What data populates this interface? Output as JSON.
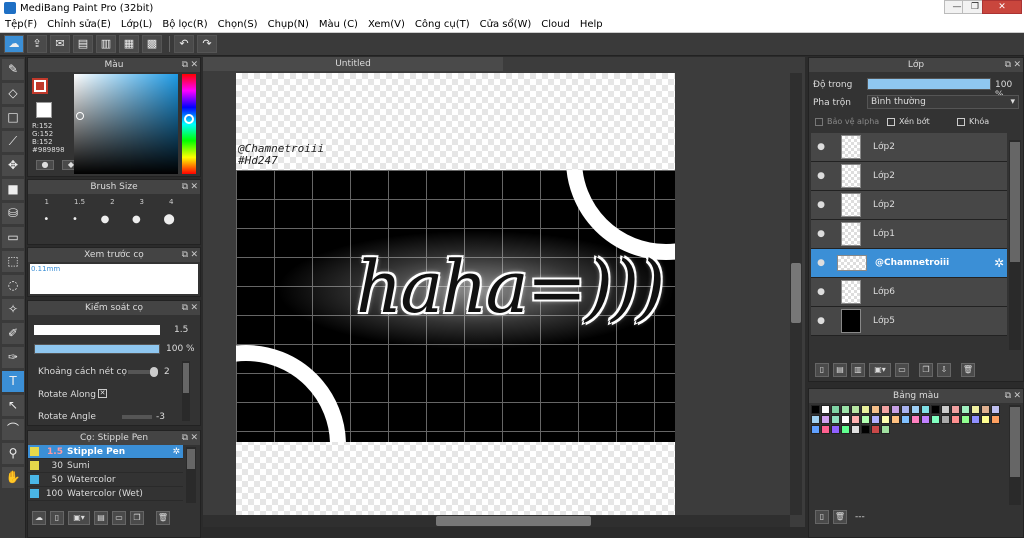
{
  "window": {
    "title": "MediBang Paint Pro (32bit)"
  },
  "menu": [
    "Tệp(F)",
    "Chỉnh sửa(E)",
    "Lớp(L)",
    "Bộ lọc(R)",
    "Chọn(S)",
    "Chụp(N)",
    "Màu (C)",
    "Xem(V)",
    "Công cụ(T)",
    "Cửa sổ(W)",
    "Cloud",
    "Help"
  ],
  "color_panel": {
    "title": "Màu",
    "r": "R:152",
    "g": "G:152",
    "b": "B:152",
    "hex": "#989898",
    "primary": "#c0392b",
    "secondary": "#989898"
  },
  "brush_size_panel": {
    "title": "Brush Size",
    "sizes": [
      "1",
      "1.5",
      "2",
      "3",
      "4"
    ]
  },
  "preview_panel": {
    "title": "Xem trước cọ",
    "value": "0.11mm"
  },
  "brush_control": {
    "title": "Kiểm soát cọ",
    "size_value": "1.5",
    "opacity_value": "100 %",
    "spacing_label": "Khoảng cách nét cọ",
    "spacing_value": "2",
    "rotate_along_label": "Rotate Along",
    "rotate_angle_label": "Rotate Angle",
    "rotate_angle_value": "-3"
  },
  "brush_list": {
    "title": "Cọ: Stipple Pen",
    "items": [
      {
        "size": "1.5",
        "name": "Stipple Pen",
        "color": "#e6d84a"
      },
      {
        "size": "30",
        "name": "Sumi",
        "color": "#e6d84a"
      },
      {
        "size": "50",
        "name": "Watercolor",
        "color": "#4ab6e6"
      },
      {
        "size": "100",
        "name": "Watercolor (Wet)",
        "color": "#4ab6e6"
      }
    ]
  },
  "document": {
    "tab": "Untitled",
    "credit_line1": "@Chamnetroiii",
    "credit_line2": "#Hd247",
    "art_text": "haha=)))"
  },
  "layer_panel": {
    "title": "Lớp",
    "opacity_label": "Độ trong",
    "opacity_value": "100 %",
    "opacity_fraction": 1.0,
    "blend_label": "Pha trộn",
    "blend_value": "Bình thường",
    "protect_alpha": "Bảo vệ alpha",
    "clipping": "Xén bớt",
    "lock": "Khóa",
    "layers": [
      "Lớp2",
      "Lớp2",
      "Lớp2",
      "Lớp1",
      "@Chamnetroiii",
      "Lớp6",
      "Lớp5"
    ],
    "selected_index": 4
  },
  "palette_panel": {
    "title": "Bảng màu",
    "colors": [
      "#000000",
      "#ffffff",
      "#7fd3a4",
      "#9be3a8",
      "#b7e6a3",
      "#e9f09c",
      "#f5c08a",
      "#f3a3a3",
      "#c7a0e5",
      "#a9b3f0",
      "#9fd0f5",
      "#7fe0e6",
      "#000000",
      "#cccccc",
      "#f0a0a0",
      "#a0f0c0",
      "#f0f0a0",
      "#e0b090",
      "#c0c0f0",
      "#a0d0f0",
      "#d0a0f0",
      "#90e0c0",
      "#ffffff",
      "#ffb0b0",
      "#b0ffb0",
      "#b0b0ff",
      "#ffffb0",
      "#ffc080",
      "#80c0ff",
      "#ff80c0",
      "#c080ff",
      "#80ffc0",
      "#aaaaaa",
      "#ff9090",
      "#90ff90",
      "#9090ff",
      "#ffff90",
      "#ffa060",
      "#60a0ff",
      "#ff6090",
      "#9060ff",
      "#60ff90",
      "#e0e0e0",
      "#000000",
      "#c94848",
      "#a0e0a0"
    ],
    "footer": "---"
  }
}
